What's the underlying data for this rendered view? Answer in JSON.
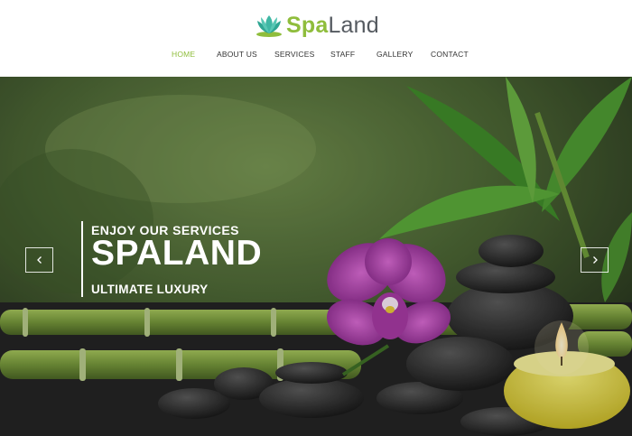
{
  "brand": {
    "name_part1": "Spa",
    "name_part2": "Land",
    "icon": "lotus-icon",
    "colors": {
      "accent": "#8fbd3c",
      "text": "#555a60",
      "lotus": "#3fb7a4"
    }
  },
  "nav": {
    "items": [
      {
        "label": "HOME",
        "active": true
      },
      {
        "label": "ABOUT US",
        "active": false
      },
      {
        "label": "SERVICES",
        "active": false
      },
      {
        "label": "STAFF",
        "active": false
      },
      {
        "label": "GALLERY",
        "active": false
      },
      {
        "label": "CONTACT",
        "active": false
      }
    ]
  },
  "hero": {
    "subtitle": "ENJOY OUR SERVICES",
    "title": "SPALAND",
    "tagline": "ULTIMATE LUXURY",
    "prev_icon": "chevron-left-icon",
    "next_icon": "chevron-right-icon"
  }
}
